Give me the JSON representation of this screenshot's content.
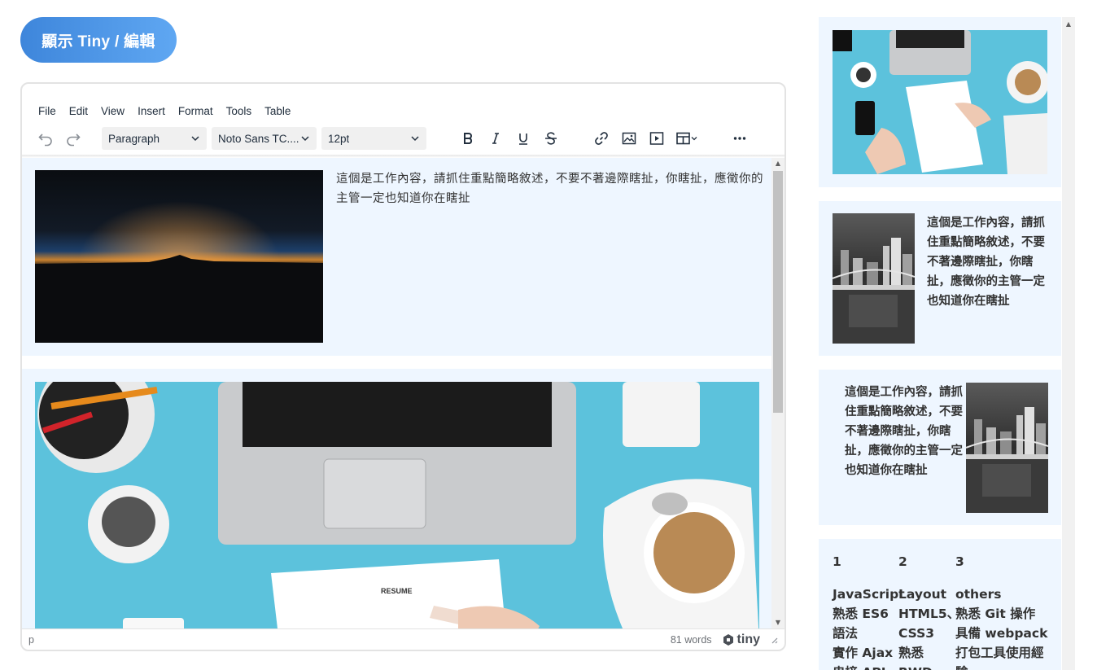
{
  "toggle_button": {
    "label": "顯示 Tiny / 編輯"
  },
  "editor": {
    "menu": [
      "File",
      "Edit",
      "View",
      "Insert",
      "Format",
      "Tools",
      "Table"
    ],
    "toolbar": {
      "block_format": "Paragraph",
      "font_family": "Noto Sans TC....",
      "font_size": "12pt"
    },
    "content": {
      "block1_text": "這個是工作內容，請抓住重點簡略敘述，不要不著邊際瞎扯，你瞎扯，應徵你的主管一定也知道你在瞎扯"
    },
    "status": {
      "path": "p",
      "word_count": "81 words",
      "brand": "tiny"
    }
  },
  "sidebar": {
    "card2_text": "這個是工作內容，請抓住重點簡略敘述，不要不著邊際瞎扯，你瞎扯，應徵你的主管一定也知道你在瞎扯",
    "card3_text": "這個是工作內容，請抓住重點簡略敘述，不要不著邊際瞎扯，你瞎扯，應徵你的主管一定也知道你在瞎扯",
    "skills": {
      "headers": [
        "1",
        "2",
        "3"
      ],
      "columns": [
        "JavaScript",
        "Layout",
        "others"
      ],
      "rows": [
        [
          "熟悉 ES6",
          "HTML5、",
          "熟悉 Git 操作"
        ],
        [
          "語法",
          "CSS3",
          "具備 webpack"
        ],
        [
          "實作 Ajax",
          "熟悉",
          "打包工具使用經"
        ],
        [
          "串接 API",
          "RWD",
          "驗"
        ]
      ]
    }
  },
  "colors": {
    "accent_start": "#3e86db",
    "accent_end": "#5fa7f2",
    "block_bg": "#eef6ff",
    "desk_blue": "#5cc2dc"
  }
}
